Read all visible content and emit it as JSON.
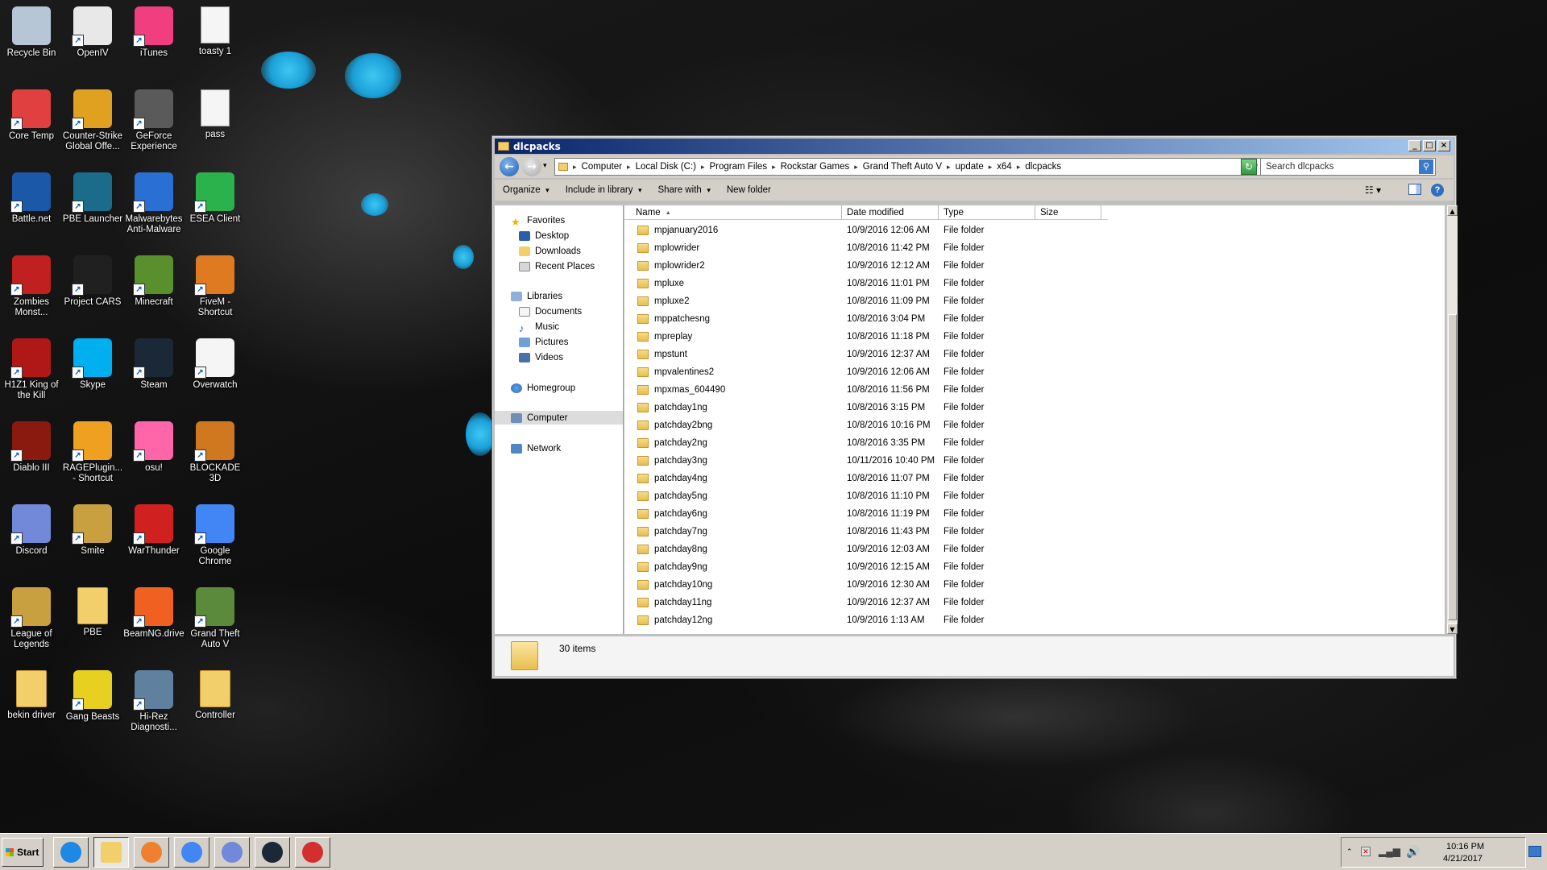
{
  "desktop": {
    "icons": [
      {
        "label": "Recycle Bin",
        "icon": "recycle-bin-icon",
        "color": "#b7c6d6"
      },
      {
        "label": "OpenIV",
        "icon": "openiv-icon",
        "color": "#e8e8e8"
      },
      {
        "label": "iTunes",
        "icon": "itunes-icon",
        "color": "#f03e7f"
      },
      {
        "label": "toasty 1",
        "icon": "text-file-icon",
        "color": "#f5f5f5"
      },
      {
        "label": "Core Temp",
        "icon": "core-temp-icon",
        "color": "#e04040"
      },
      {
        "label": "Counter-Strike Global Offe...",
        "icon": "csgo-icon",
        "color": "#e0a020"
      },
      {
        "label": "GeForce Experience",
        "icon": "geforce-icon",
        "color": "#5a5a5a"
      },
      {
        "label": "pass",
        "icon": "text-file-icon",
        "color": "#f5f5f5"
      },
      {
        "label": "Battle.net",
        "icon": "battlenet-icon",
        "color": "#1b58a8"
      },
      {
        "label": "PBE Launcher",
        "icon": "pbe-launcher-icon",
        "color": "#1b6b8a"
      },
      {
        "label": "Malwarebytes Anti-Malware",
        "icon": "malwarebytes-icon",
        "color": "#2a6fd4"
      },
      {
        "label": "ESEA Client",
        "icon": "esea-icon",
        "color": "#2bb24c"
      },
      {
        "label": "Zombies Monst...",
        "icon": "zmr-icon",
        "color": "#c02020"
      },
      {
        "label": "Project CARS",
        "icon": "project-cars-icon",
        "color": "#202020"
      },
      {
        "label": "Minecraft",
        "icon": "minecraft-icon",
        "color": "#5a8f2e"
      },
      {
        "label": "FiveM - Shortcut",
        "icon": "fivem-icon",
        "color": "#e07a20"
      },
      {
        "label": "H1Z1 King of the Kill",
        "icon": "h1z1-icon",
        "color": "#b01818"
      },
      {
        "label": "Skype",
        "icon": "skype-icon",
        "color": "#00aff0"
      },
      {
        "label": "Steam",
        "icon": "steam-icon",
        "color": "#1b2838"
      },
      {
        "label": "Overwatch",
        "icon": "overwatch-icon",
        "color": "#f5f5f5"
      },
      {
        "label": "Diablo III",
        "icon": "diablo-icon",
        "color": "#8a1a10"
      },
      {
        "label": "RAGEPlugin... - Shortcut",
        "icon": "rage-icon",
        "color": "#f0a020"
      },
      {
        "label": "osu!",
        "icon": "osu-icon",
        "color": "#ff66aa"
      },
      {
        "label": "BLOCKADE 3D",
        "icon": "blockade-icon",
        "color": "#d07820"
      },
      {
        "label": "Discord",
        "icon": "discord-icon",
        "color": "#7289da"
      },
      {
        "label": "Smite",
        "icon": "smite-icon",
        "color": "#c8a040"
      },
      {
        "label": "WarThunder",
        "icon": "warthunder-icon",
        "color": "#d02020"
      },
      {
        "label": "Google Chrome",
        "icon": "chrome-icon",
        "color": "#4285f4"
      },
      {
        "label": "League of Legends",
        "icon": "league-icon",
        "color": "#c8a040"
      },
      {
        "label": "PBE",
        "icon": "folder-icon",
        "color": "#f2cf6b"
      },
      {
        "label": "BeamNG.drive",
        "icon": "beamng-icon",
        "color": "#f06020"
      },
      {
        "label": "Grand Theft Auto V",
        "icon": "gta-icon",
        "color": "#5a8a3a"
      },
      {
        "label": "bekin driver",
        "icon": "folder-icon",
        "color": "#f2cf6b"
      },
      {
        "label": "Gang Beasts",
        "icon": "gang-beasts-icon",
        "color": "#e8d020"
      },
      {
        "label": "Hi-Rez Diagnosti...",
        "icon": "hirez-icon",
        "color": "#6080a0"
      },
      {
        "label": "Controller",
        "icon": "folder-icon",
        "color": "#f2cf6b"
      }
    ]
  },
  "window": {
    "title": "dlcpacks",
    "breadcrumbs": [
      "Computer",
      "Local Disk (C:)",
      "Program Files",
      "Rockstar Games",
      "Grand Theft Auto V",
      "update",
      "x64",
      "dlcpacks"
    ],
    "search_placeholder": "Search dlcpacks",
    "toolbar": {
      "organize": "Organize",
      "include": "Include in library",
      "share": "Share with",
      "new_folder": "New folder"
    },
    "nav": {
      "favorites": "Favorites",
      "desktop": "Desktop",
      "downloads": "Downloads",
      "recent": "Recent Places",
      "libraries": "Libraries",
      "documents": "Documents",
      "music": "Music",
      "pictures": "Pictures",
      "videos": "Videos",
      "homegroup": "Homegroup",
      "computer": "Computer",
      "network": "Network"
    },
    "columns": {
      "name": "Name",
      "date": "Date modified",
      "type": "Type",
      "size": "Size"
    },
    "files": [
      {
        "name": "mpjanuary2016",
        "date": "10/9/2016 12:06 AM",
        "type": "File folder"
      },
      {
        "name": "mplowrider",
        "date": "10/8/2016 11:42 PM",
        "type": "File folder"
      },
      {
        "name": "mplowrider2",
        "date": "10/9/2016 12:12 AM",
        "type": "File folder"
      },
      {
        "name": "mpluxe",
        "date": "10/8/2016 11:01 PM",
        "type": "File folder"
      },
      {
        "name": "mpluxe2",
        "date": "10/8/2016 11:09 PM",
        "type": "File folder"
      },
      {
        "name": "mppatchesng",
        "date": "10/8/2016 3:04 PM",
        "type": "File folder"
      },
      {
        "name": "mpreplay",
        "date": "10/8/2016 11:18 PM",
        "type": "File folder"
      },
      {
        "name": "mpstunt",
        "date": "10/9/2016 12:37 AM",
        "type": "File folder"
      },
      {
        "name": "mpvalentines2",
        "date": "10/9/2016 12:06 AM",
        "type": "File folder"
      },
      {
        "name": "mpxmas_604490",
        "date": "10/8/2016 11:56 PM",
        "type": "File folder"
      },
      {
        "name": "patchday1ng",
        "date": "10/8/2016 3:15 PM",
        "type": "File folder"
      },
      {
        "name": "patchday2bng",
        "date": "10/8/2016 10:16 PM",
        "type": "File folder"
      },
      {
        "name": "patchday2ng",
        "date": "10/8/2016 3:35 PM",
        "type": "File folder"
      },
      {
        "name": "patchday3ng",
        "date": "10/11/2016 10:40 PM",
        "type": "File folder"
      },
      {
        "name": "patchday4ng",
        "date": "10/8/2016 11:07 PM",
        "type": "File folder"
      },
      {
        "name": "patchday5ng",
        "date": "10/8/2016 11:10 PM",
        "type": "File folder"
      },
      {
        "name": "patchday6ng",
        "date": "10/8/2016 11:19 PM",
        "type": "File folder"
      },
      {
        "name": "patchday7ng",
        "date": "10/8/2016 11:43 PM",
        "type": "File folder"
      },
      {
        "name": "patchday8ng",
        "date": "10/9/2016 12:03 AM",
        "type": "File folder"
      },
      {
        "name": "patchday9ng",
        "date": "10/9/2016 12:15 AM",
        "type": "File folder"
      },
      {
        "name": "patchday10ng",
        "date": "10/9/2016 12:30 AM",
        "type": "File folder"
      },
      {
        "name": "patchday11ng",
        "date": "10/9/2016 12:37 AM",
        "type": "File folder"
      },
      {
        "name": "patchday12ng",
        "date": "10/9/2016 1:13 AM",
        "type": "File folder"
      }
    ],
    "item_count": "30 items"
  },
  "taskbar": {
    "start": "Start",
    "apps": [
      "internet-explorer-icon",
      "file-explorer-icon",
      "media-player-icon",
      "chrome-icon",
      "discord-icon",
      "steam-icon",
      "close-error-icon"
    ],
    "time": "10:16 PM",
    "date": "4/21/2017"
  }
}
